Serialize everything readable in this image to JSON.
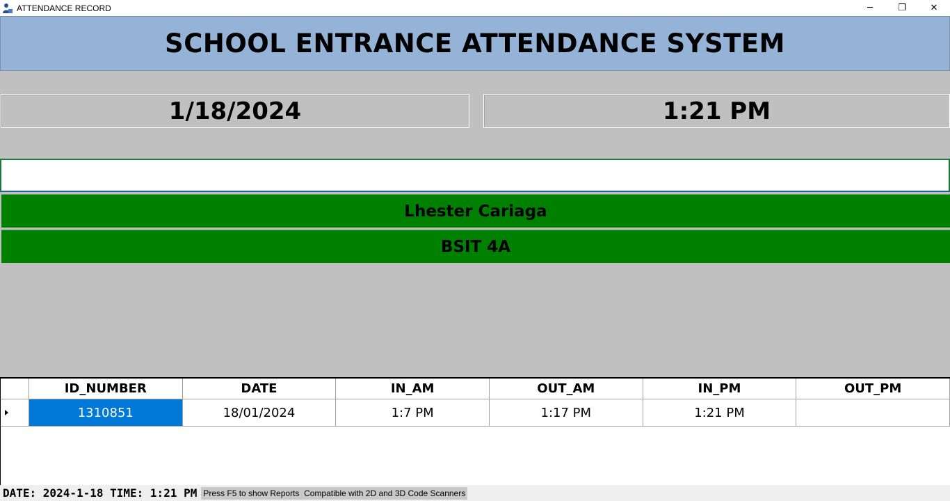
{
  "window": {
    "title": "ATTENDANCE RECORD",
    "minimize_label": "─",
    "restore_label": "❐",
    "close_label": "✕"
  },
  "header": {
    "title": "SCHOOL ENTRANCE ATTENDANCE SYSTEM",
    "background": "#95b3d7"
  },
  "clock": {
    "date": "1/18/2024",
    "time": "1:21 PM"
  },
  "scan_input": {
    "value": "",
    "placeholder": ""
  },
  "student": {
    "name": "Lhester Cariaga",
    "section": "BSIT 4A",
    "status_color": "#008000"
  },
  "grid": {
    "columns": [
      "ID_NUMBER",
      "DATE",
      "IN_AM",
      "OUT_AM",
      "IN_PM",
      "OUT_PM"
    ],
    "rows": [
      [
        "1310851",
        "18/01/2024",
        "1:7 PM",
        "1:17 PM",
        "1:21 PM",
        ""
      ]
    ],
    "selection_color": "#0078d7"
  },
  "status": {
    "main": "DATE: 2024-1-18 TIME: 1:21 PM",
    "hint": "Press F5 to show Reports  Compatible with 2D and 3D Code Scanners"
  }
}
